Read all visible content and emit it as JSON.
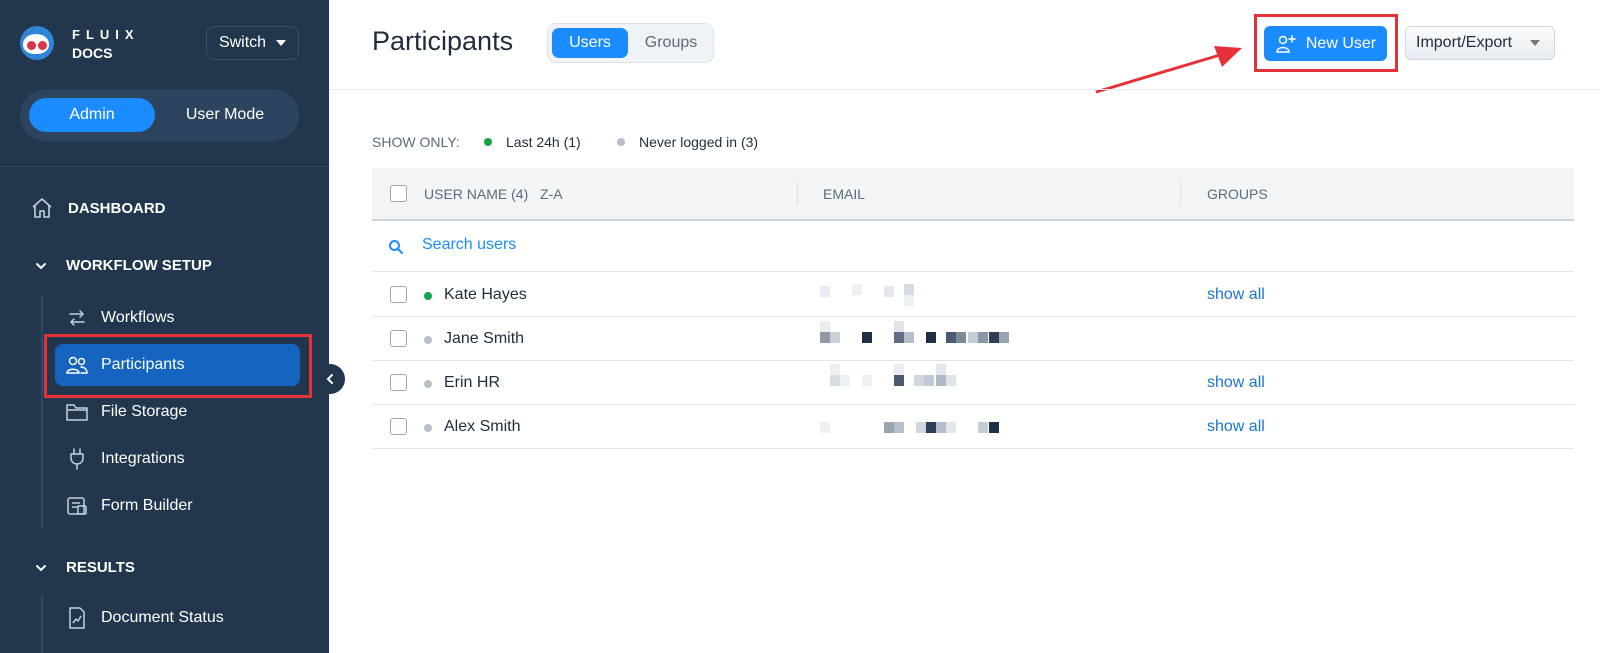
{
  "brand": {
    "line1": "FLUIX",
    "line2": "DOCS"
  },
  "switch_label": "Switch",
  "mode": {
    "admin": "Admin",
    "user": "User Mode"
  },
  "nav": {
    "dashboard": "DASHBOARD",
    "workflow_setup": "WORKFLOW SETUP",
    "items": {
      "workflows": "Workflows",
      "participants": "Participants",
      "file_storage": "File Storage",
      "integrations": "Integrations",
      "form_builder": "Form Builder"
    },
    "results": "RESULTS",
    "document_status": "Document Status"
  },
  "header": {
    "title": "Participants",
    "tabs": {
      "users": "Users",
      "groups": "Groups"
    },
    "new_user": "New User",
    "import_export": "Import/Export"
  },
  "filters": {
    "label": "SHOW ONLY:",
    "last24": "Last 24h (1)",
    "never": "Never logged in (3)"
  },
  "table": {
    "col_user": "USER NAME (4)",
    "sort": "Z-A",
    "col_email": "EMAIL",
    "col_groups": "GROUPS",
    "search_placeholder": "Search users",
    "rows": [
      {
        "name": "Kate Hayes",
        "status": "online",
        "groups": "show all"
      },
      {
        "name": "Jane Smith",
        "status": "never",
        "groups": ""
      },
      {
        "name": "Erin HR",
        "status": "never",
        "groups": "show all"
      },
      {
        "name": "Alex Smith",
        "status": "never",
        "groups": "show all"
      }
    ]
  },
  "colors": {
    "sidebar": "#22364d",
    "accent": "#1a8cff",
    "active_nav": "#1565c0",
    "online": "#16a34a",
    "never": "#b7c0ca",
    "highlight": "#e53238"
  }
}
